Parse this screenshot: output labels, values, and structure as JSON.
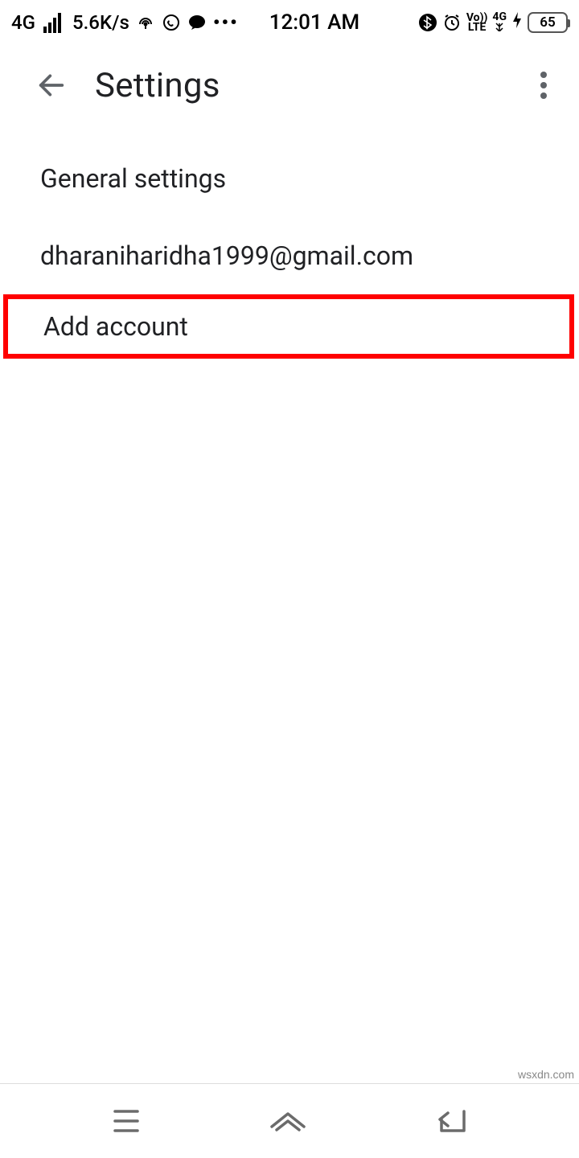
{
  "status_bar": {
    "network_label": "4G",
    "net_speed": "5.6K/s",
    "clock": "12:01 AM",
    "volte": "Vo))\nLTE",
    "sig4g": "4G",
    "battery_pct": "65"
  },
  "app_bar": {
    "title": "Settings"
  },
  "list": {
    "general": "General settings",
    "account_email": "dharaniharidha1999@gmail.com",
    "add_account": "Add account"
  },
  "watermark": "wsxdn.com"
}
